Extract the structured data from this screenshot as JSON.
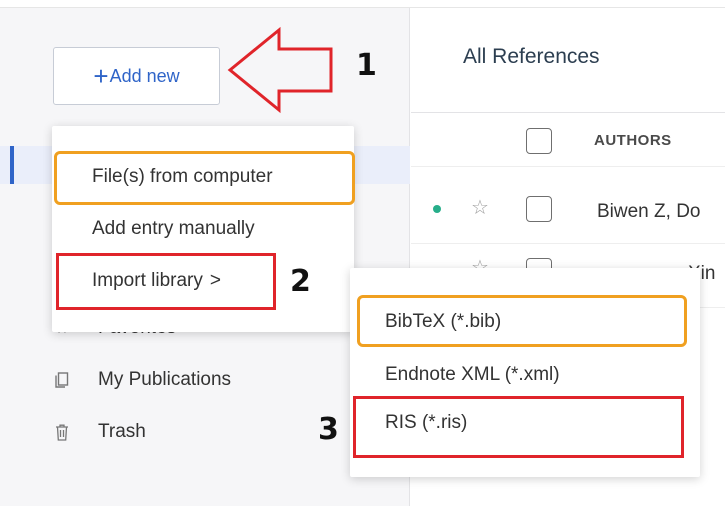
{
  "sidebar": {
    "add_new": {
      "plus": "+",
      "label": "Add new"
    },
    "items": [
      {
        "label": "Favorites",
        "icon": "star-icon"
      },
      {
        "label": "My Publications",
        "icon": "publications-icon"
      },
      {
        "label": "Trash",
        "icon": "trash-icon"
      }
    ]
  },
  "main": {
    "title": "All References",
    "columns": {
      "authors": "AUTHORS"
    },
    "rows": [
      {
        "authors": "Biwen Z, Do"
      },
      {
        "authors": "Xin"
      }
    ]
  },
  "add_menu": {
    "items": [
      {
        "label": "File(s) from computer"
      },
      {
        "label": "Add entry manually"
      },
      {
        "label": "Import library",
        "chevron": ">"
      }
    ]
  },
  "import_menu": {
    "items": [
      {
        "label": "BibTeX (*.bib)"
      },
      {
        "label": "Endnote XML (*.xml)"
      },
      {
        "label": "RIS (*.ris)"
      }
    ]
  },
  "annotations": {
    "step1": "1",
    "step2": "2",
    "step3": "3",
    "orange": "#f0a020",
    "red": "#e0242a"
  },
  "colors": {
    "accent": "#2f64c8",
    "status_dot": "#27ae8a",
    "sidebar_bg": "#f6f6f8"
  }
}
